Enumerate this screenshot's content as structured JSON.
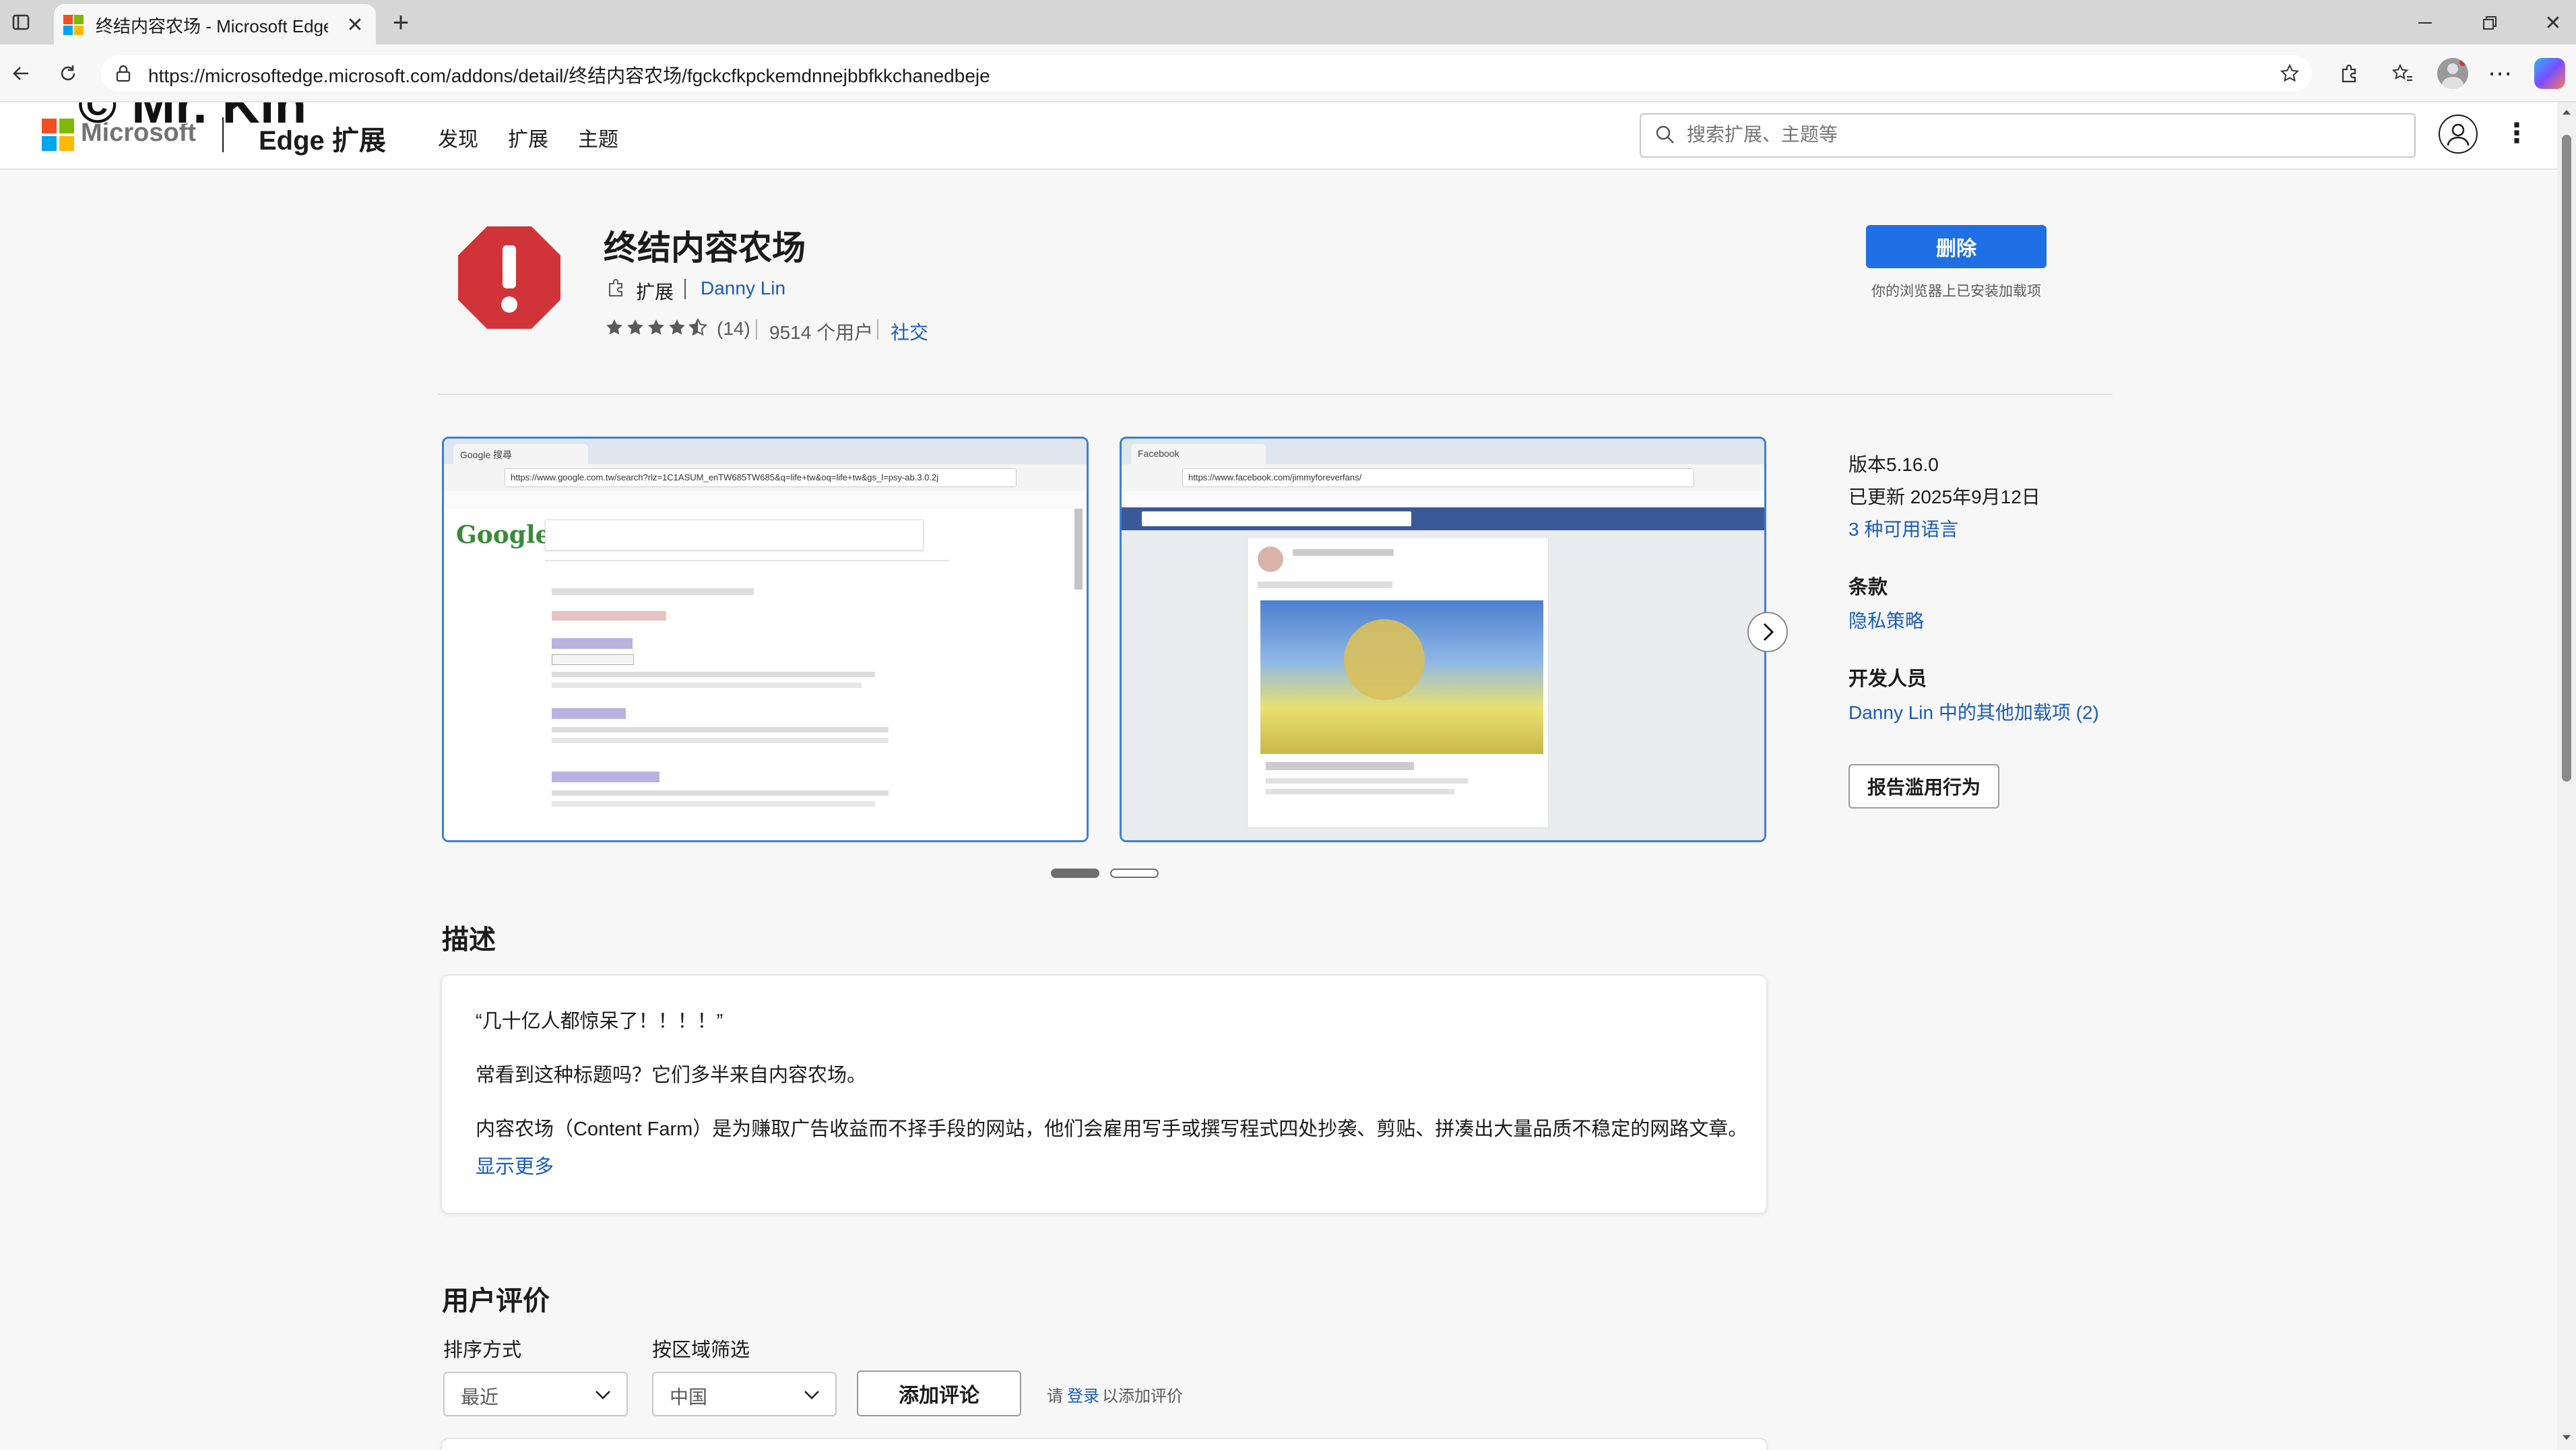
{
  "browser": {
    "tab_title": "终结内容农场 - Microsoft Edge Ad",
    "url": "https://microsoftedge.microsoft.com/addons/detail/终结内容农场/fgckcfkpckemdnnejbbfkkchanedbeje"
  },
  "watermark": "© Mr. Kin",
  "header": {
    "brand": "Microsoft",
    "section": "Edge 扩展",
    "nav": [
      "发现",
      "扩展",
      "主题"
    ],
    "search_placeholder": "搜索扩展、主题等"
  },
  "extension": {
    "name": "终结内容农场",
    "type_label": "扩展",
    "developer": "Danny Lin",
    "rating": 4.5,
    "rating_count": "(14)",
    "users": "9514 个用户",
    "category": "社交",
    "remove_button": "删除",
    "installed_note": "你的浏览器上已安装加载项"
  },
  "sidebar": {
    "version": "版本5.16.0",
    "updated": "已更新 2025年9月12日",
    "languages_link": "3 种可用语言",
    "terms_heading": "条款",
    "privacy_link": "隐私策略",
    "developer_heading": "开发人员",
    "developer_link": "Danny Lin 中的其他加载项 (2)",
    "report_button": "报告滥用行为"
  },
  "screenshots": {
    "shot1": {
      "url": "https://www.google.com.tw/search?rlz=1C1ASUM_enTW685TW685&q=life+tw&oq=life+tw&gs_l=psy-ab.3.0.2j",
      "tab": "Google 搜尋",
      "logo": "Google"
    },
    "shot2": {
      "url": "https://www.facebook.com/jimmyforeverfans/",
      "tab": "Facebook"
    }
  },
  "description": {
    "heading": "描述",
    "p1": "“几十亿人都惊呆了！！！！”",
    "p2": "常看到这种标题吗？它们多半来自内容农场。",
    "p3": "内容农场（Content Farm）是为赚取广告收益而不择手段的网站，他们会雇用写手或撰写程式四处抄袭、剪贴、拼凑出大量品质不稳定的网路文章。他...",
    "show_more": "显示更多"
  },
  "reviews": {
    "heading": "用户评价",
    "sort_label": "排序方式",
    "sort_value": "最近",
    "region_label": "按区域筛选",
    "region_value": "中国",
    "add_review": "添加评论",
    "login_prefix": "请",
    "login_link": "登录",
    "login_suffix": "以添加评价"
  },
  "colors": {
    "accent": "#1f6fe5",
    "link": "#1a5bb8",
    "icon_red": "#d13438"
  }
}
